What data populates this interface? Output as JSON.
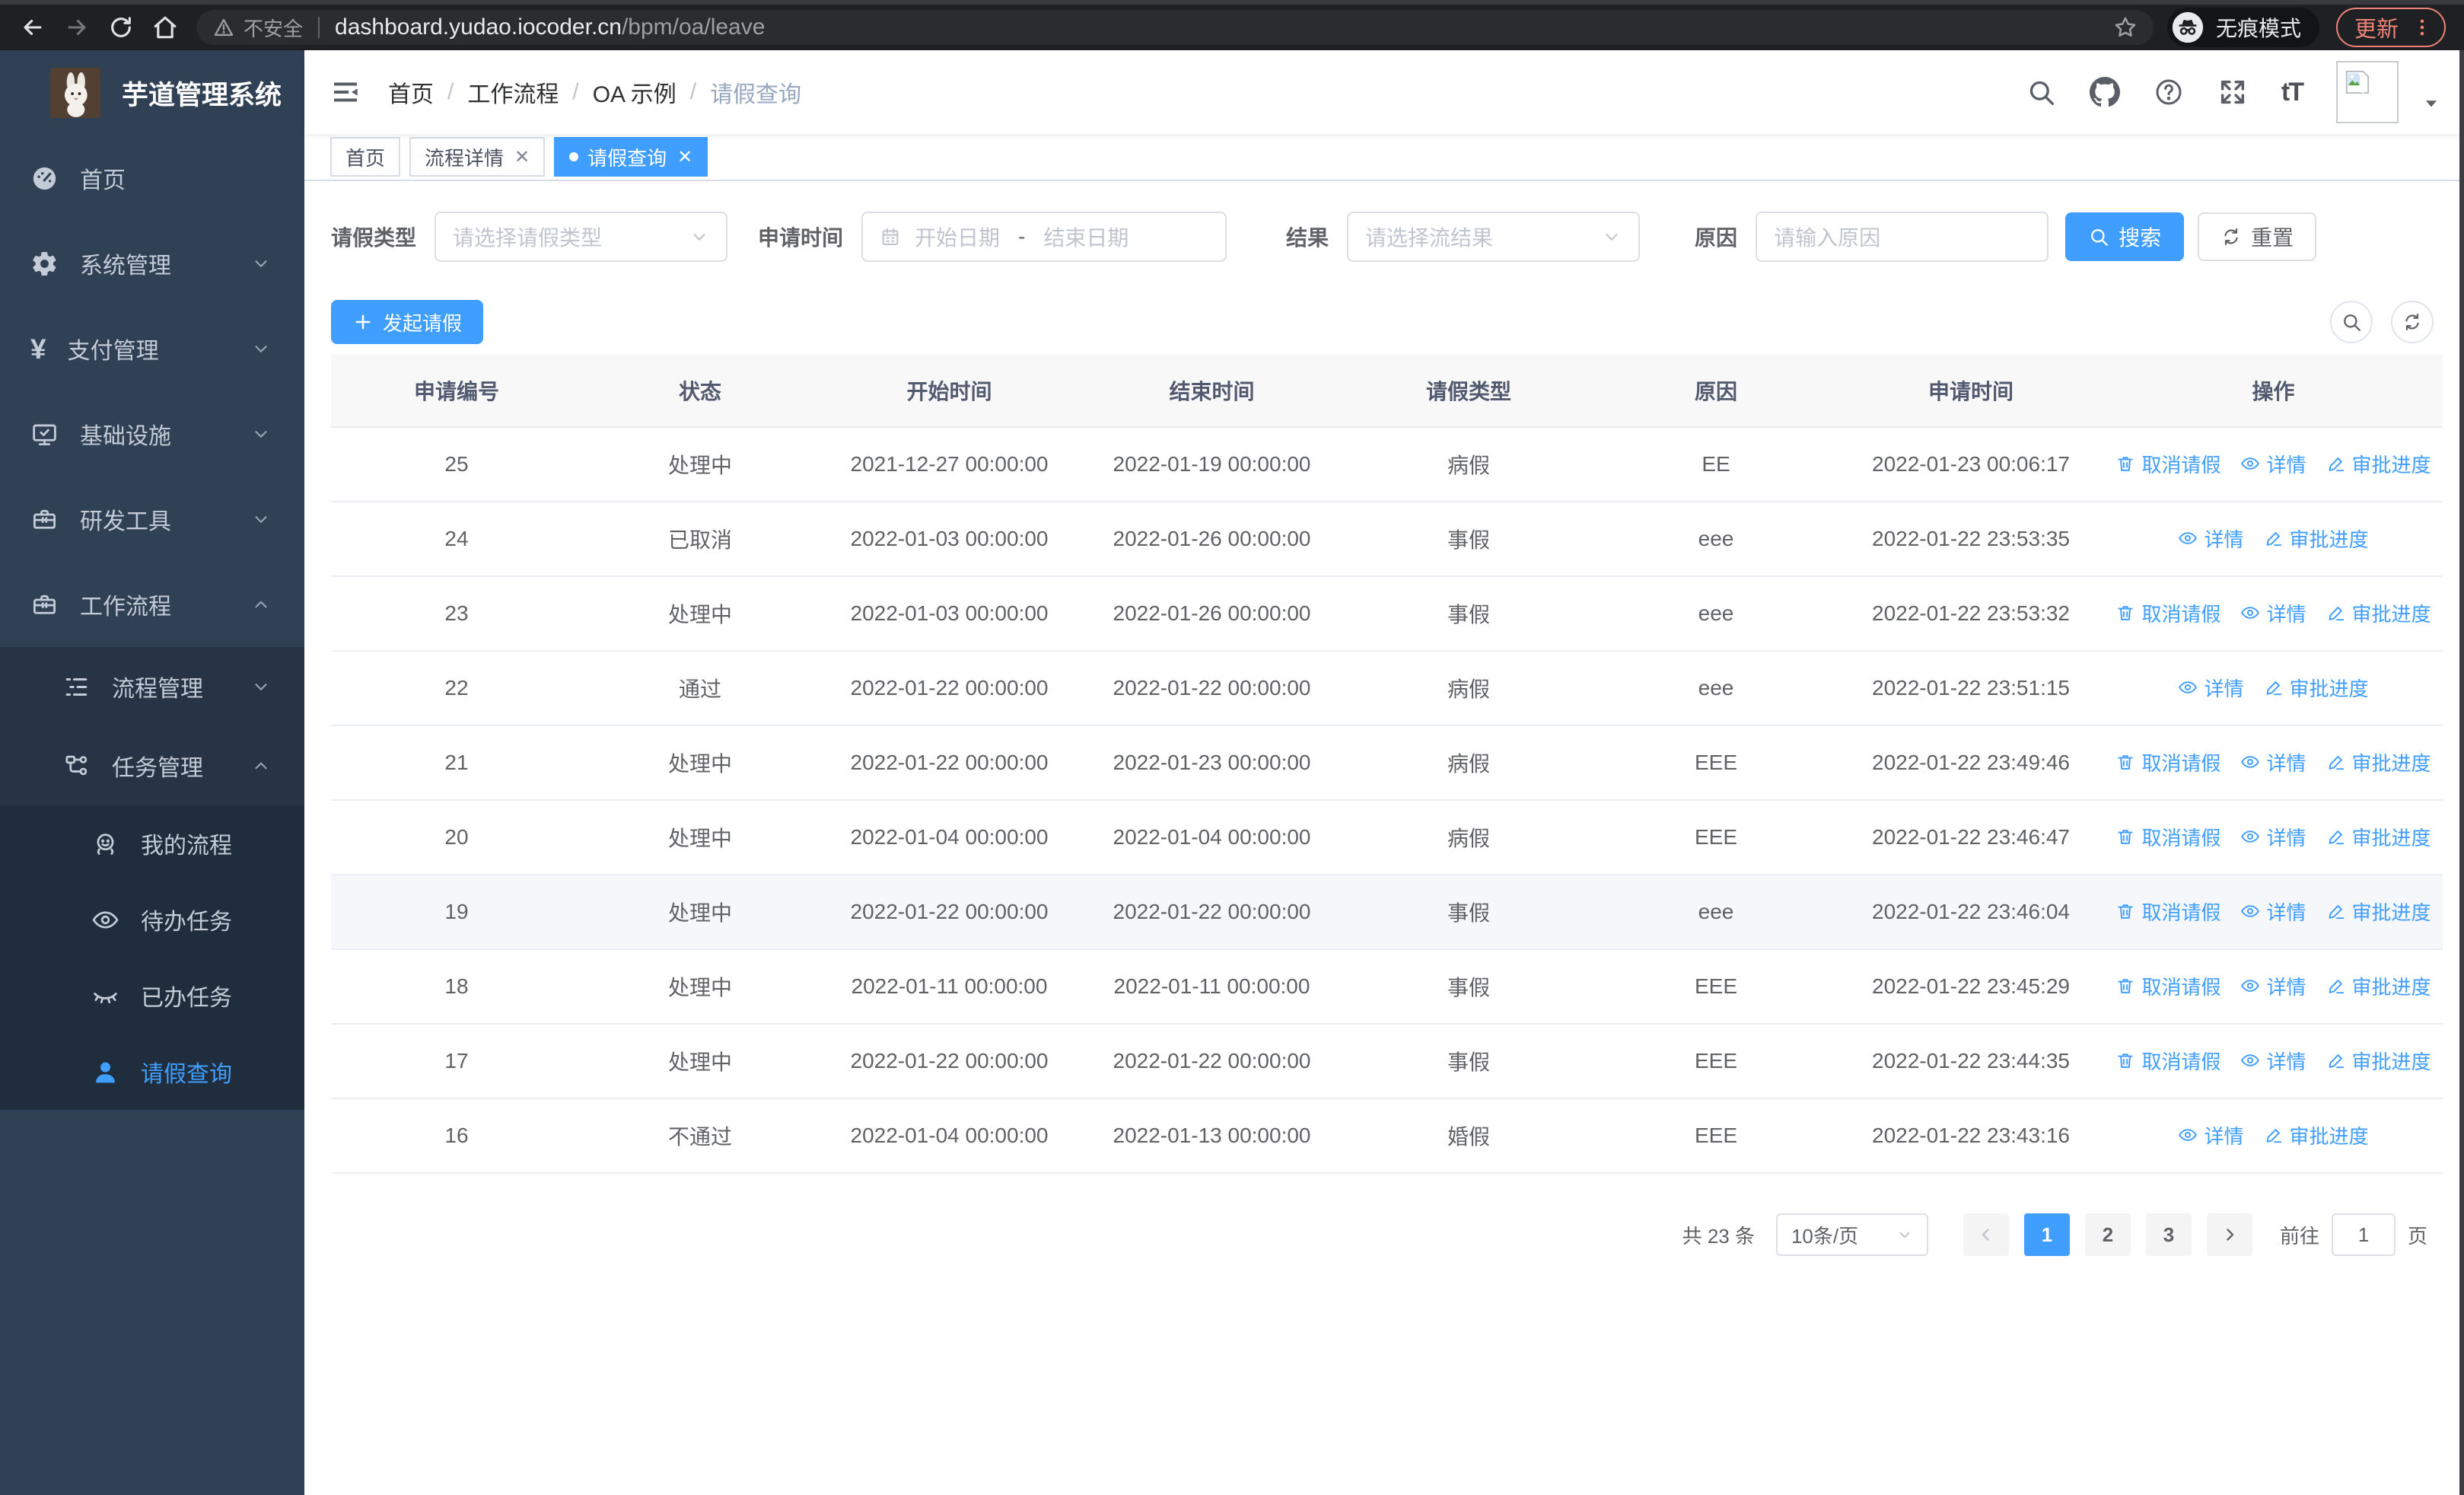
{
  "browser": {
    "security_label": "不安全",
    "url_host": "dashboard.yudao.iocoder.cn",
    "url_path": "/bpm/oa/leave",
    "incognito_label": "无痕模式",
    "update_label": "更新"
  },
  "sidebar": {
    "app_title": "芋道管理系统",
    "menu": [
      {
        "label": "首页",
        "icon": "gauge-icon",
        "level": 1
      },
      {
        "label": "系统管理",
        "icon": "gear-icon",
        "level": 1,
        "chevron": "down"
      },
      {
        "label": "支付管理",
        "icon": "yen-icon",
        "level": 1,
        "chevron": "down"
      },
      {
        "label": "基础设施",
        "icon": "monitor-icon",
        "level": 1,
        "chevron": "down"
      },
      {
        "label": "研发工具",
        "icon": "toolbox-icon",
        "level": 1,
        "chevron": "down"
      },
      {
        "label": "工作流程",
        "icon": "toolbox-icon",
        "level": 1,
        "chevron": "up"
      },
      {
        "label": "流程管理",
        "icon": "tree-icon",
        "level": 2,
        "chevron": "down"
      },
      {
        "label": "任务管理",
        "icon": "flow-icon",
        "level": 2,
        "chevron": "up"
      },
      {
        "label": "我的流程",
        "icon": "face-icon",
        "level": 3
      },
      {
        "label": "待办任务",
        "icon": "eye-open-icon",
        "level": 3
      },
      {
        "label": "已办任务",
        "icon": "eye-closed-icon",
        "level": 3
      },
      {
        "label": "请假查询",
        "icon": "user-icon",
        "level": 3,
        "active": true
      }
    ]
  },
  "header": {
    "breadcrumb": [
      "首页",
      "工作流程",
      "OA 示例",
      "请假查询"
    ]
  },
  "tabs": [
    {
      "label": "首页",
      "active": false,
      "closable": false
    },
    {
      "label": "流程详情",
      "active": false,
      "closable": true
    },
    {
      "label": "请假查询",
      "active": true,
      "closable": true
    }
  ],
  "filters": {
    "fields": [
      {
        "label": "请假类型",
        "placeholder": "请选择请假类型"
      },
      {
        "label": "申请时间",
        "start_placeholder": "开始日期",
        "separator": "-",
        "end_placeholder": "结束日期"
      },
      {
        "label": "结果",
        "placeholder": "请选择流结果"
      },
      {
        "label": "原因",
        "placeholder": "请输入原因"
      }
    ],
    "search_label": "搜索",
    "reset_label": "重置"
  },
  "toolbar": {
    "create_label": "发起请假"
  },
  "table": {
    "columns": [
      "申请编号",
      "状态",
      "开始时间",
      "结束时间",
      "请假类型",
      "原因",
      "申请时间",
      "操作"
    ],
    "action_labels": {
      "cancel": "取消请假",
      "detail": "详情",
      "progress": "审批进度"
    },
    "rows": [
      {
        "id": "25",
        "status": "处理中",
        "start": "2021-12-27 00:00:00",
        "end": "2022-01-19 00:00:00",
        "type": "病假",
        "reason": "EE",
        "apply_time": "2022-01-23 00:06:17",
        "actions": [
          "cancel",
          "detail",
          "progress"
        ]
      },
      {
        "id": "24",
        "status": "已取消",
        "start": "2022-01-03 00:00:00",
        "end": "2022-01-26 00:00:00",
        "type": "事假",
        "reason": "eee",
        "apply_time": "2022-01-22 23:53:35",
        "actions": [
          "detail",
          "progress"
        ]
      },
      {
        "id": "23",
        "status": "处理中",
        "start": "2022-01-03 00:00:00",
        "end": "2022-01-26 00:00:00",
        "type": "事假",
        "reason": "eee",
        "apply_time": "2022-01-22 23:53:32",
        "actions": [
          "cancel",
          "detail",
          "progress"
        ]
      },
      {
        "id": "22",
        "status": "通过",
        "start": "2022-01-22 00:00:00",
        "end": "2022-01-22 00:00:00",
        "type": "病假",
        "reason": "eee",
        "apply_time": "2022-01-22 23:51:15",
        "actions": [
          "detail",
          "progress"
        ]
      },
      {
        "id": "21",
        "status": "处理中",
        "start": "2022-01-22 00:00:00",
        "end": "2022-01-23 00:00:00",
        "type": "病假",
        "reason": "EEE",
        "apply_time": "2022-01-22 23:49:46",
        "actions": [
          "cancel",
          "detail",
          "progress"
        ]
      },
      {
        "id": "20",
        "status": "处理中",
        "start": "2022-01-04 00:00:00",
        "end": "2022-01-04 00:00:00",
        "type": "病假",
        "reason": "EEE",
        "apply_time": "2022-01-22 23:46:47",
        "actions": [
          "cancel",
          "detail",
          "progress"
        ]
      },
      {
        "id": "19",
        "status": "处理中",
        "start": "2022-01-22 00:00:00",
        "end": "2022-01-22 00:00:00",
        "type": "事假",
        "reason": "eee",
        "apply_time": "2022-01-22 23:46:04",
        "actions": [
          "cancel",
          "detail",
          "progress"
        ],
        "highlight": true
      },
      {
        "id": "18",
        "status": "处理中",
        "start": "2022-01-11 00:00:00",
        "end": "2022-01-11 00:00:00",
        "type": "事假",
        "reason": "EEE",
        "apply_time": "2022-01-22 23:45:29",
        "actions": [
          "cancel",
          "detail",
          "progress"
        ]
      },
      {
        "id": "17",
        "status": "处理中",
        "start": "2022-01-22 00:00:00",
        "end": "2022-01-22 00:00:00",
        "type": "事假",
        "reason": "EEE",
        "apply_time": "2022-01-22 23:44:35",
        "actions": [
          "cancel",
          "detail",
          "progress"
        ]
      },
      {
        "id": "16",
        "status": "不通过",
        "start": "2022-01-04 00:00:00",
        "end": "2022-01-13 00:00:00",
        "type": "婚假",
        "reason": "EEE",
        "apply_time": "2022-01-22 23:43:16",
        "actions": [
          "detail",
          "progress"
        ]
      }
    ]
  },
  "pagination": {
    "total_label": "共 23 条",
    "page_size": "10条/页",
    "pages": [
      "1",
      "2",
      "3"
    ],
    "active_page": "1",
    "goto_label": "前往",
    "goto_value": "1",
    "unit_label": "页"
  },
  "colors": {
    "primary": "#409eff",
    "sidebar": "#304156",
    "update_accent": "#ee8277"
  }
}
